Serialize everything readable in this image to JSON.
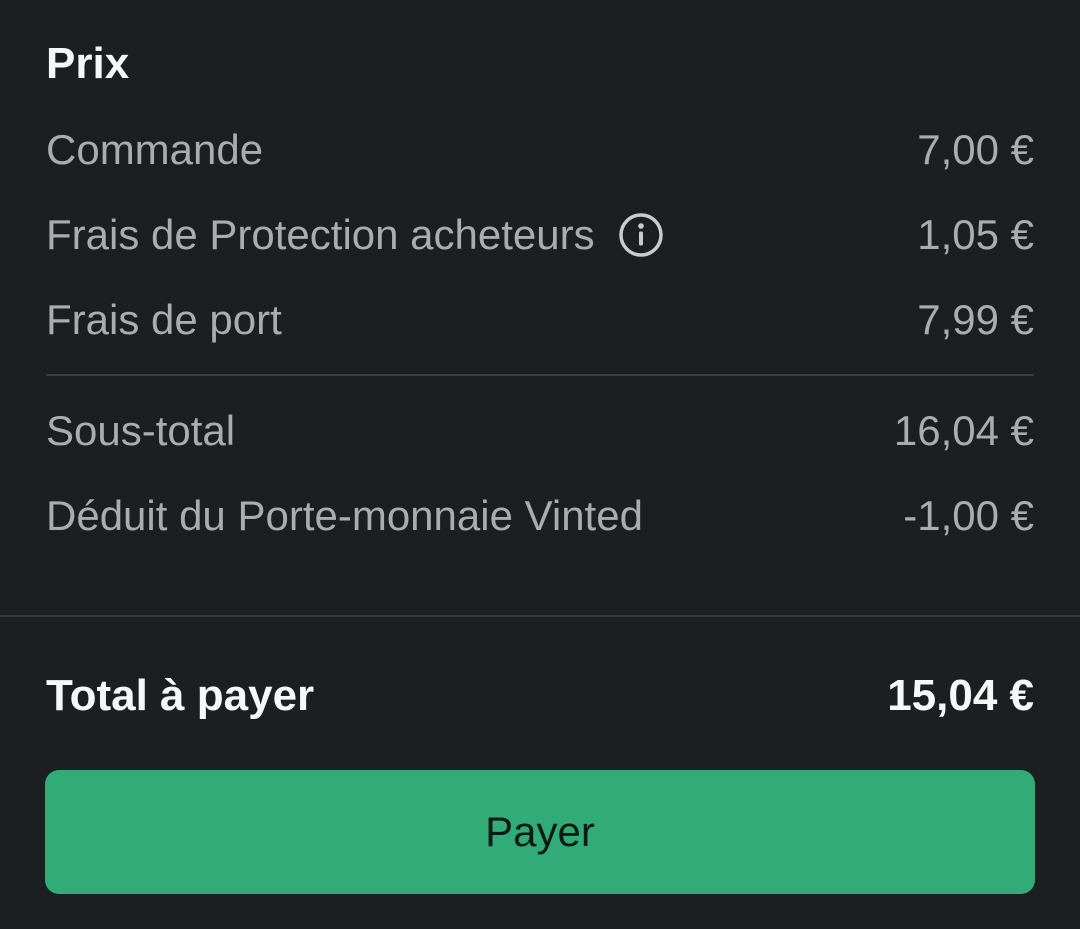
{
  "price_section": {
    "title": "Prix",
    "rows": [
      {
        "label": "Commande",
        "value": "7,00 €"
      },
      {
        "label": "Frais de Protection acheteurs",
        "value": "1,05 €",
        "icon": "info-icon"
      },
      {
        "label": "Frais de port",
        "value": "7,99 €"
      }
    ],
    "subtotal_rows": [
      {
        "label": "Sous-total",
        "value": "16,04 €"
      },
      {
        "label": "Déduit du Porte-monnaie Vinted",
        "value": "-1,00 €"
      }
    ]
  },
  "total": {
    "label": "Total à payer",
    "value": "15,04 €"
  },
  "pay_button": {
    "label": "Payer"
  },
  "colors": {
    "background": "#1b1f20",
    "accent": "#31ac78",
    "primary_text": "#f6f7f7",
    "secondary_text": "#a9adae"
  }
}
